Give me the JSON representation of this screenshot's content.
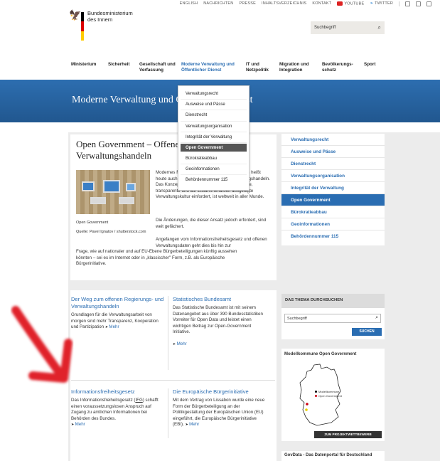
{
  "topbar": {
    "links": [
      "ENGLISH",
      "NACHRICHTEN",
      "PRESSE",
      "INHALTSVERZEICHNIS",
      "KONTAKT"
    ],
    "youtube": "YOUTUBE",
    "twitter": "TWITTER"
  },
  "logo": {
    "line1": "Bundesministerium",
    "line2": "des Innern"
  },
  "search_top": {
    "placeholder": "Suchbegriff"
  },
  "main_nav": [
    {
      "label": "Ministerium"
    },
    {
      "label": "Sicherheit"
    },
    {
      "label": "Gesellschaft und Verfassung"
    },
    {
      "label": "Moderne Verwaltung und Öffentlicher Dienst",
      "active": true
    },
    {
      "label": "IT und Netzpolitik"
    },
    {
      "label": "Migration und Integration"
    },
    {
      "label": "Bevölkerungs-schutz"
    },
    {
      "label": "Sport"
    }
  ],
  "banner": {
    "title": "Moderne Verwaltung und Öffentlicher Dienst"
  },
  "dropdown": [
    "Verwaltungsrecht",
    "Ausweise und Pässe",
    "Dienstrecht",
    "Verwaltungsorganisation",
    "Integrität der Verwaltung",
    "Open Government",
    "Bürokratieabbau",
    "Geoinformationen",
    "Behördennummer 115"
  ],
  "dropdown_active_index": 5,
  "article": {
    "title": "Open Government – Offenes Regierungs- und Verwaltungshandeln",
    "caption": "Open Government",
    "source": "Quelle: Pavel Ignatov / shutterstock.com",
    "p1": "Modernes Regierungs- und Verwaltungshandeln heißt heute auch: offenes Regierungs- und Verwaltungshandeln. Das Konzept \"Open Government\", das eine neue, transparente und auf Zusammenarbeit ausgelegte Verwaltungskultur einfordert, ist weltweit in aller Munde.",
    "p2": "Die Änderungen, die dieser Ansatz jedoch erfordert, sind weit gefächert.",
    "p3": "Angefangen vom Informationsfreiheitsgesetz und offenen Verwaltungsdaten geht dies bis hin zur",
    "p4": "Frage, wie auf nationaler und auf EU-Ebene Bürgerbeteiligungen künftig aussehen könnten – sei es im Internet oder in „klassischer\" Form, z.B. als Europäische Bürgerinitiative."
  },
  "teasers": [
    {
      "title": "Der Weg zum offenen Regierungs- und Verwaltungshandeln",
      "text": "Grundlagen für die Verwaltungsarbeit von morgen sind mehr Transparenz, Kooperation und Partizipation",
      "more": "Mehr"
    },
    {
      "title": "Statistisches Bundesamt",
      "text": "Das Statistische Bundesamt ist mit seinem Datenangebot aus über 390 Bundesstatistiken Vorreiter für Open Data und leistet einen wichtigen Beitrag zur Open-Government Initiative.",
      "more": "Mehr"
    },
    {
      "title": "Informationsfreiheitsgesetz",
      "text_pre": "Das Informationsfreiheitsgesetz (",
      "abbr": "IFG",
      "text_post": ") schafft einen voraussetzungslosen Anspruch auf Zugang zu amtlichen Informationen bei Behörden des Bundes.",
      "more": "Mehr"
    },
    {
      "title": "Die Europäische Bürgerinitiative",
      "text": "Mit dem Vertrag von Lissabon wurde eine neue Form der Bürgerbeteiligung an der Politikgestaltung der Europäischen Union (EU) eingeführt, die Europäische Bürgerinitiative (EBI).",
      "more": "Mehr"
    }
  ],
  "right_nav": [
    "Verwaltungsrecht",
    "Ausweise und Pässe",
    "Dienstrecht",
    "Verwaltungsorganisation",
    "Integrität der Verwaltung",
    "Open Government",
    "Bürokratieabbau",
    "Geoinformationen",
    "Behördennummer 115"
  ],
  "right_nav_active_index": 5,
  "theme_search": {
    "heading": "DAS THEMA DURCHSUCHEN",
    "placeholder": "Suchbegriff",
    "button": "SUCHEN"
  },
  "modellkommune": {
    "heading": "Modellkommune Open Government",
    "legend1": "Modellkommune",
    "legend2": "Open Government",
    "button": "ZUM PROJEKTWETTBEWERB"
  },
  "govdata": {
    "heading": "GovData - Das Datenportal für Deutschland"
  },
  "colors": {
    "accent": "#2a6db2",
    "banner": "#21578f",
    "annotation_arrow": "#e0202a"
  }
}
